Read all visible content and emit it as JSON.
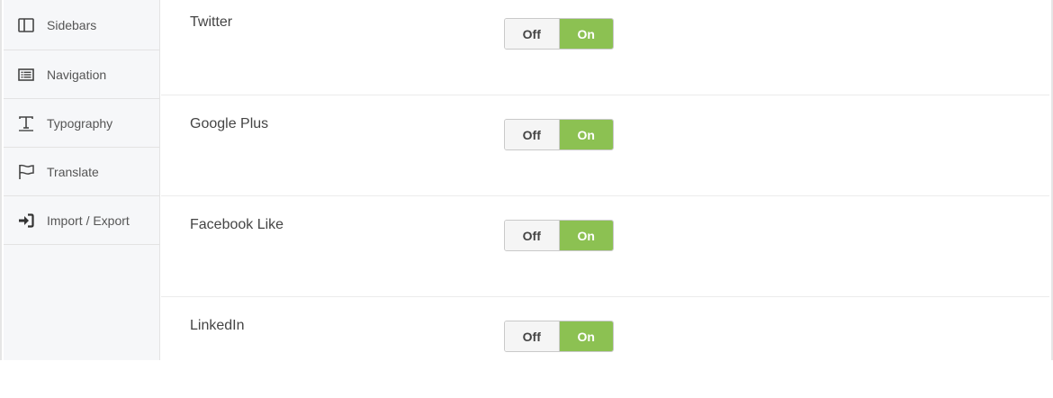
{
  "colors": {
    "toggle_on_bg": "#8cc152",
    "sidebar_bg": "#f6f7f9"
  },
  "sidebar": {
    "items": [
      {
        "label": "Sidebars",
        "icon": "sidebar-columns-icon"
      },
      {
        "label": "Navigation",
        "icon": "list-icon"
      },
      {
        "label": "Typography",
        "icon": "text-icon"
      },
      {
        "label": "Translate",
        "icon": "flag-icon"
      },
      {
        "label": "Import / Export",
        "icon": "sign-in-icon"
      }
    ]
  },
  "settings": {
    "rows": [
      {
        "label": "Twitter",
        "off_label": "Off",
        "on_label": "On",
        "state": "on"
      },
      {
        "label": "Google Plus",
        "off_label": "Off",
        "on_label": "On",
        "state": "on"
      },
      {
        "label": "Facebook Like",
        "off_label": "Off",
        "on_label": "On",
        "state": "on"
      },
      {
        "label": "LinkedIn",
        "off_label": "Off",
        "on_label": "On",
        "state": "on"
      }
    ]
  }
}
